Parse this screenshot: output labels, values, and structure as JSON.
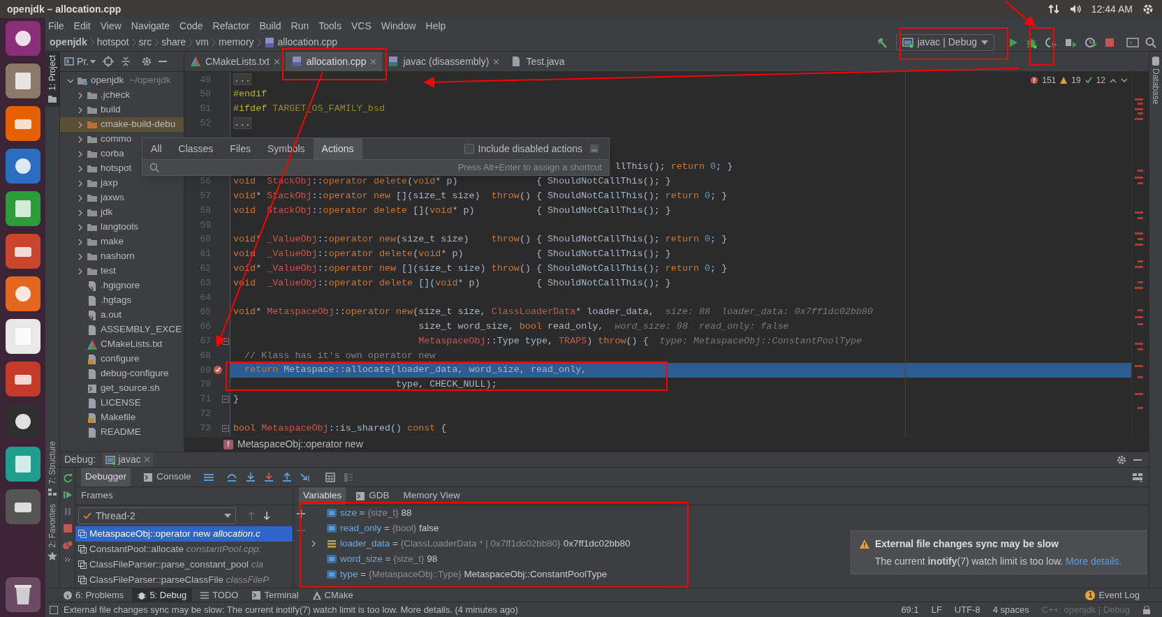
{
  "window": {
    "title": "openjdk – allocation.cpp"
  },
  "system_tray": {
    "clock": "12:44 AM"
  },
  "menu": [
    "File",
    "Edit",
    "View",
    "Navigate",
    "Code",
    "Refactor",
    "Build",
    "Run",
    "Tools",
    "VCS",
    "Window",
    "Help"
  ],
  "breadcrumbs": [
    "openjdk",
    "hotspot",
    "src",
    "share",
    "vm",
    "memory",
    "allocation.cpp"
  ],
  "run_config": {
    "label": "javac | Debug"
  },
  "left_strip": [
    {
      "label": "1: Project",
      "selected": true,
      "kind": "project"
    },
    {
      "label": "7: Structure",
      "selected": false,
      "kind": "structure"
    },
    {
      "label": "2: Favorites",
      "selected": false,
      "kind": "favorites"
    }
  ],
  "right_strip": [
    {
      "label": "Database"
    }
  ],
  "project": {
    "title": "Pr.",
    "tree": [
      {
        "label": "openjdk",
        "path": "~/openjdk",
        "kind": "module",
        "expanded": true,
        "selected": false,
        "children": [
          {
            "label": ".jcheck",
            "kind": "folder",
            "expanded": false,
            "selected": false
          },
          {
            "label": "build",
            "kind": "folder",
            "expanded": false,
            "selected": false
          },
          {
            "label": "cmake-build-debu",
            "kind": "excluded",
            "expanded": false,
            "selected": true
          },
          {
            "label": "commo",
            "kind": "folder",
            "expanded": false,
            "selected": false
          },
          {
            "label": "corba",
            "kind": "folder",
            "expanded": false,
            "selected": false
          },
          {
            "label": "hotspot",
            "kind": "folder",
            "expanded": false,
            "selected": false
          },
          {
            "label": "jaxp",
            "kind": "folder",
            "expanded": false,
            "selected": false
          },
          {
            "label": "jaxws",
            "kind": "folder",
            "expanded": false,
            "selected": false
          },
          {
            "label": "jdk",
            "kind": "folder",
            "expanded": false,
            "selected": false
          },
          {
            "label": "langtools",
            "kind": "folder",
            "expanded": false,
            "selected": false
          },
          {
            "label": "make",
            "kind": "folder",
            "expanded": false,
            "selected": false
          },
          {
            "label": "nashorn",
            "kind": "folder",
            "expanded": false,
            "selected": false
          },
          {
            "label": "test",
            "kind": "folder",
            "expanded": false,
            "selected": false
          },
          {
            "label": ".hgignore",
            "kind": "unknown",
            "selected": false
          },
          {
            "label": ".hgtags",
            "kind": "file",
            "selected": false
          },
          {
            "label": "a.out",
            "kind": "unknown",
            "selected": false
          },
          {
            "label": "ASSEMBLY_EXCE",
            "kind": "file",
            "selected": false
          },
          {
            "label": "CMakeLists.txt",
            "kind": "cmake",
            "selected": false
          },
          {
            "label": "configure",
            "kind": "script",
            "selected": false
          },
          {
            "label": "debug-configure",
            "kind": "file",
            "selected": false
          },
          {
            "label": "get_source.sh",
            "kind": "shell",
            "selected": false
          },
          {
            "label": "LICENSE",
            "kind": "file",
            "selected": false
          },
          {
            "label": "Makefile",
            "kind": "script",
            "selected": false
          },
          {
            "label": "README",
            "kind": "file",
            "selected": false
          }
        ]
      }
    ]
  },
  "editor_tabs": [
    {
      "label": "CMakeLists.txt",
      "kind": "cmake",
      "selected": false,
      "closable": true
    },
    {
      "label": "allocation.cpp",
      "kind": "cpp",
      "selected": true,
      "closable": true
    },
    {
      "label": "javac (disassembly)",
      "kind": "asm",
      "selected": false,
      "closable": true
    },
    {
      "label": "Test.java",
      "kind": "file",
      "selected": false,
      "closable": false
    }
  ],
  "inspections": {
    "errors": "151",
    "warnings": "19",
    "ok": "12"
  },
  "code_lines": [
    {
      "number": "49",
      "kind": "code",
      "current": false,
      "tokens": [
        {
          "kind": "fold",
          "text": "..."
        }
      ]
    },
    {
      "number": "50",
      "kind": "code",
      "current": false,
      "tokens": [
        {
          "kind": "pp",
          "text": "#endif"
        }
      ]
    },
    {
      "number": "51",
      "kind": "code",
      "current": false,
      "tokens": [
        {
          "kind": "pp",
          "text": "#ifdef"
        },
        {
          "kind": "macro",
          "text": " TARGET_OS_FAMILY_bsd"
        }
      ]
    },
    {
      "number": "52",
      "kind": "code",
      "current": false,
      "tokens": [
        {
          "kind": "fold",
          "text": "..."
        }
      ]
    },
    {
      "kind": "blank",
      "current": false
    },
    {
      "kind": "blank",
      "current": false
    },
    {
      "kind": "partial",
      "current": false,
      "tokens": [
        {
          "kind": "plain",
          "text": "llThis(); "
        },
        {
          "kind": "kw",
          "text": "return "
        },
        {
          "kind": "num",
          "text": "0"
        },
        {
          "kind": "plain",
          "text": "; }"
        }
      ]
    },
    {
      "number": "56",
      "kind": "code",
      "current": false,
      "tokens": [
        {
          "kind": "kw",
          "text": "void  "
        },
        {
          "kind": "cls",
          "text": "StackObj"
        },
        {
          "kind": "plain",
          "text": "::"
        },
        {
          "kind": "kw",
          "text": "operator delete"
        },
        {
          "kind": "plain",
          "text": "("
        },
        {
          "kind": "kw",
          "text": "void"
        },
        {
          "kind": "plain",
          "text": "* p)              { ShouldNotCallThis(); }"
        }
      ]
    },
    {
      "number": "57",
      "kind": "code",
      "current": false,
      "tokens": [
        {
          "kind": "kw",
          "text": "void"
        },
        {
          "kind": "plain",
          "text": "* "
        },
        {
          "kind": "cls",
          "text": "StackObj"
        },
        {
          "kind": "plain",
          "text": "::"
        },
        {
          "kind": "kw",
          "text": "operator new"
        },
        {
          "kind": "plain",
          "text": " [](size_t size)  "
        },
        {
          "kind": "kw",
          "text": "throw"
        },
        {
          "kind": "plain",
          "text": "() { ShouldNotCallThis(); "
        },
        {
          "kind": "kw",
          "text": "return "
        },
        {
          "kind": "num",
          "text": "0"
        },
        {
          "kind": "plain",
          "text": "; }"
        }
      ]
    },
    {
      "number": "58",
      "kind": "code",
      "current": false,
      "tokens": [
        {
          "kind": "kw",
          "text": "void  "
        },
        {
          "kind": "cls",
          "text": "StackObj"
        },
        {
          "kind": "plain",
          "text": "::"
        },
        {
          "kind": "kw",
          "text": "operator delete"
        },
        {
          "kind": "plain",
          "text": " []("
        },
        {
          "kind": "kw",
          "text": "void"
        },
        {
          "kind": "plain",
          "text": "* p)           { ShouldNotCallThis(); }"
        }
      ]
    },
    {
      "number": "59",
      "kind": "blank",
      "current": false
    },
    {
      "number": "60",
      "kind": "code",
      "current": false,
      "tokens": [
        {
          "kind": "kw",
          "text": "void"
        },
        {
          "kind": "plain",
          "text": "* "
        },
        {
          "kind": "cls",
          "text": "_ValueObj"
        },
        {
          "kind": "plain",
          "text": "::"
        },
        {
          "kind": "kw",
          "text": "operator new"
        },
        {
          "kind": "plain",
          "text": "(size_t size)    "
        },
        {
          "kind": "kw",
          "text": "throw"
        },
        {
          "kind": "plain",
          "text": "() { ShouldNotCallThis(); "
        },
        {
          "kind": "kw",
          "text": "return "
        },
        {
          "kind": "num",
          "text": "0"
        },
        {
          "kind": "plain",
          "text": "; }"
        }
      ]
    },
    {
      "number": "61",
      "kind": "code",
      "current": false,
      "tokens": [
        {
          "kind": "kw",
          "text": "void  "
        },
        {
          "kind": "cls",
          "text": "_ValueObj"
        },
        {
          "kind": "plain",
          "text": "::"
        },
        {
          "kind": "kw",
          "text": "operator delete"
        },
        {
          "kind": "plain",
          "text": "("
        },
        {
          "kind": "kw",
          "text": "void"
        },
        {
          "kind": "plain",
          "text": "* p)             { ShouldNotCallThis(); }"
        }
      ]
    },
    {
      "number": "62",
      "kind": "code",
      "current": false,
      "tokens": [
        {
          "kind": "kw",
          "text": "void"
        },
        {
          "kind": "plain",
          "text": "* "
        },
        {
          "kind": "cls",
          "text": "_ValueObj"
        },
        {
          "kind": "plain",
          "text": "::"
        },
        {
          "kind": "kw",
          "text": "operator new"
        },
        {
          "kind": "plain",
          "text": " [](size_t size) "
        },
        {
          "kind": "kw",
          "text": "throw"
        },
        {
          "kind": "plain",
          "text": "() { ShouldNotCallThis(); "
        },
        {
          "kind": "kw",
          "text": "return "
        },
        {
          "kind": "num",
          "text": "0"
        },
        {
          "kind": "plain",
          "text": "; }"
        }
      ]
    },
    {
      "number": "63",
      "kind": "code",
      "current": false,
      "tokens": [
        {
          "kind": "kw",
          "text": "void  "
        },
        {
          "kind": "cls",
          "text": "_ValueObj"
        },
        {
          "kind": "plain",
          "text": "::"
        },
        {
          "kind": "kw",
          "text": "operator delete"
        },
        {
          "kind": "plain",
          "text": " []("
        },
        {
          "kind": "kw",
          "text": "void"
        },
        {
          "kind": "plain",
          "text": "* p)          { ShouldNotCallThis(); }"
        }
      ]
    },
    {
      "number": "64",
      "kind": "blank",
      "current": false
    },
    {
      "number": "65",
      "kind": "code",
      "current": false,
      "tokens": [
        {
          "kind": "kw",
          "text": "void"
        },
        {
          "kind": "plain",
          "text": "* "
        },
        {
          "kind": "cls",
          "text": "MetaspaceObj"
        },
        {
          "kind": "plain",
          "text": "::"
        },
        {
          "kind": "kw",
          "text": "operator new"
        },
        {
          "kind": "plain",
          "text": "(size_t size, "
        },
        {
          "kind": "cls",
          "text": "ClassLoaderData"
        },
        {
          "kind": "plain",
          "text": "* loader_data,  "
        },
        {
          "kind": "hint",
          "text": "size: 88  loader_data: 0x7ff1dc02bb80"
        }
      ]
    },
    {
      "number": "66",
      "kind": "code",
      "current": false,
      "tokens": [
        {
          "kind": "plain",
          "text": "                                 size_t word_size, "
        },
        {
          "kind": "kw",
          "text": "bool"
        },
        {
          "kind": "plain",
          "text": " read_only,  "
        },
        {
          "kind": "hint",
          "text": "word_size: 98  read_only: false"
        }
      ]
    },
    {
      "number": "67",
      "kind": "code",
      "current": false,
      "marker": {
        "kind": "fold"
      },
      "tokens": [
        {
          "kind": "cls",
          "text": "                                 MetaspaceObj"
        },
        {
          "kind": "plain",
          "text": "::Type type, "
        },
        {
          "kind": "cls",
          "text": "TRAPS"
        },
        {
          "kind": "plain",
          "text": ") "
        },
        {
          "kind": "kw",
          "text": "throw"
        },
        {
          "kind": "plain",
          "text": "() {  "
        },
        {
          "kind": "hint",
          "text": "type: MetaspaceObj::ConstantPoolType"
        }
      ]
    },
    {
      "number": "68",
      "kind": "code",
      "current": false,
      "tokens": [
        {
          "kind": "comment",
          "text": "  // Klass has it's own operator new"
        }
      ]
    },
    {
      "number": "69",
      "kind": "code",
      "current": true,
      "marker": {
        "kind": "breakpoint"
      },
      "tokens": [
        {
          "kind": "kw",
          "text": "  return"
        },
        {
          "kind": "plain",
          "text": " Metaspace::allocate(loader_data, word_size, read_only,"
        }
      ]
    },
    {
      "number": "70",
      "kind": "code",
      "current": false,
      "tokens": [
        {
          "kind": "plain",
          "text": "                             type, CHECK_NULL);"
        }
      ]
    },
    {
      "number": "71",
      "kind": "code",
      "current": false,
      "marker": {
        "kind": "fold"
      },
      "tokens": [
        {
          "kind": "plain",
          "text": "}"
        }
      ]
    },
    {
      "number": "72",
      "kind": "blank",
      "current": false
    },
    {
      "number": "73",
      "kind": "code",
      "current": false,
      "marker": {
        "kind": "fold"
      },
      "tokens": [
        {
          "kind": "kw",
          "text": "bool"
        },
        {
          "kind": "cls",
          "text": " MetaspaceObj"
        },
        {
          "kind": "plain",
          "text": "::is_shared() "
        },
        {
          "kind": "kw",
          "text": "const"
        },
        {
          "kind": "plain",
          "text": " {"
        }
      ]
    }
  ],
  "editor_breadcrumb": {
    "badge": "f",
    "label": "MetaspaceObj::operator new"
  },
  "popup": {
    "tabs": [
      {
        "label": "All",
        "selected": false
      },
      {
        "label": "Classes",
        "selected": false
      },
      {
        "label": "Files",
        "selected": false
      },
      {
        "label": "Symbols",
        "selected": false
      },
      {
        "label": "Actions",
        "selected": true
      }
    ],
    "checkbox": {
      "label": "Include disabled actions",
      "checked": false
    },
    "hint": "Press Alt+Enter to assign a shortcut"
  },
  "debug": {
    "title": "Debug:",
    "session": "javac",
    "tabs": [
      {
        "label": "Debugger",
        "selected": true
      },
      {
        "label": "Console",
        "selected": false
      }
    ],
    "frames_title": "Frames",
    "thread": "Thread-2",
    "frames": [
      {
        "function": "MetaspaceObj::operator new",
        "location": "allocation.c",
        "selected": true
      },
      {
        "function": "ConstantPool::allocate",
        "location": "constantPool.cpp:",
        "selected": false
      },
      {
        "function": "ClassFileParser::parse_constant_pool",
        "location": "cla",
        "selected": false
      },
      {
        "function": "ClassFileParser::parseClassFile",
        "location": "classFileP",
        "selected": false
      }
    ],
    "variable_tabs": [
      {
        "label": "Variables",
        "selected": true,
        "kind": "plain"
      },
      {
        "label": "GDB",
        "selected": false,
        "kind": "console"
      },
      {
        "label": "Memory View",
        "selected": false,
        "kind": "plain"
      }
    ],
    "variables": [
      {
        "name": "size",
        "op": "=",
        "type": "{size_t}",
        "value": "88",
        "expandable": false
      },
      {
        "name": "read_only",
        "op": "=",
        "type": "{bool}",
        "value": "false",
        "expandable": false
      },
      {
        "name": "loader_data",
        "op": "=",
        "type": "{ClassLoaderData * | 0x7ff1dc02bb80}",
        "value": "0x7ff1dc02bb80",
        "expandable": true
      },
      {
        "name": "word_size",
        "op": "=",
        "type": "{size_t}",
        "value": "98",
        "expandable": false
      },
      {
        "name": "type",
        "op": "=",
        "type": "{MetaspaceObj::Type}",
        "value": "MetaspaceObj::ConstantPoolType",
        "expandable": false
      }
    ]
  },
  "notification": {
    "title": "External file changes sync may be slow",
    "body": "The current **inotify**(7) watch limit is too low.",
    "link": "More details."
  },
  "tool_tabs": [
    {
      "label": "6: Problems",
      "kind": "problems",
      "selected": false
    },
    {
      "label": "5: Debug",
      "kind": "debug",
      "selected": true
    },
    {
      "label": "TODO",
      "kind": "todo",
      "selected": false
    },
    {
      "label": "Terminal",
      "kind": "terminal",
      "selected": false
    },
    {
      "label": "CMake",
      "kind": "cmake",
      "selected": false
    }
  ],
  "event_log": {
    "label": "Event Log",
    "badge": "1"
  },
  "status_bar": {
    "message": "External file changes sync may be slow: The current inotify(7) watch limit is too low. More details. (4 minutes ago)",
    "items": [
      {
        "text": "69:1",
        "dim": false
      },
      {
        "text": "LF",
        "dim": false
      },
      {
        "text": "UTF-8",
        "dim": false
      },
      {
        "text": "4 spaces",
        "dim": false
      },
      {
        "text": "C++: openjdk | Debug",
        "dim": true
      }
    ]
  }
}
